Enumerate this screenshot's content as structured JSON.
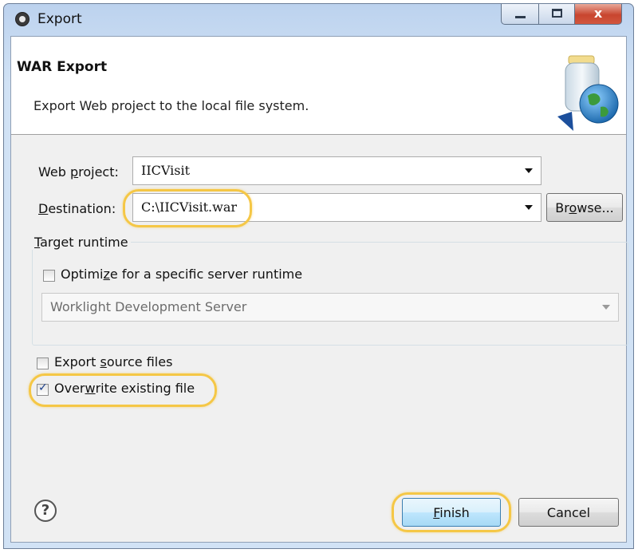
{
  "window": {
    "title": "Export",
    "controls": {
      "minimize": "minimize",
      "maximize": "maximize",
      "close": "x"
    }
  },
  "header": {
    "title": "WAR Export",
    "description": "Export Web project to the local file system."
  },
  "form": {
    "web_project": {
      "label_pre": "Web ",
      "label_ul": "p",
      "label_post": "roject:",
      "value": "IICVisit"
    },
    "destination": {
      "label_pre": "",
      "label_ul": "D",
      "label_post": "estination:",
      "value": "C:\\IICVisit.war"
    },
    "browse": {
      "label_pre": "Br",
      "label_ul": "o",
      "label_post": "wse..."
    }
  },
  "target_runtime": {
    "legend_pre": "",
    "legend_ul": "T",
    "legend_post": "arget runtime",
    "optimize": {
      "label_pre": "Optimi",
      "label_ul": "z",
      "label_post": "e for a specific server runtime",
      "checked": false
    },
    "server": {
      "value": "Worklight Development Server"
    }
  },
  "options": {
    "export_source": {
      "label_pre": "Export ",
      "label_ul": "s",
      "label_post": "ource files",
      "checked": false
    },
    "overwrite": {
      "label_pre": "Over",
      "label_ul": "w",
      "label_post": "rite existing file",
      "checked": true
    }
  },
  "footer": {
    "help": "?",
    "finish": {
      "label_pre": "",
      "label_ul": "F",
      "label_post": "inish"
    },
    "cancel": "Cancel"
  },
  "colors": {
    "highlight": "#f5c746",
    "titlebar": "#c5d9f1",
    "close_button": "#c8452f"
  }
}
